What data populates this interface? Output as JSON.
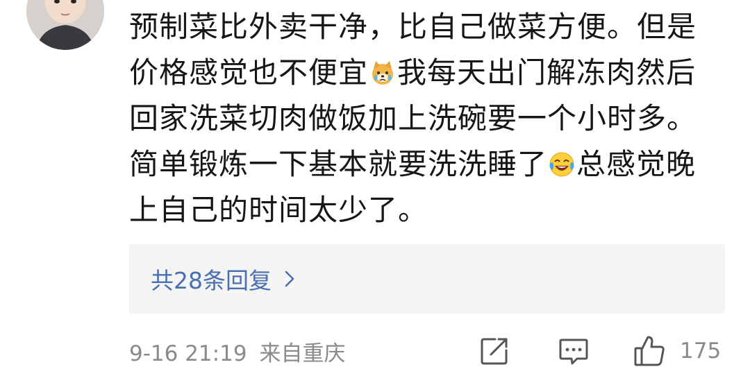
{
  "comment": {
    "lines": [
      [
        "预制菜比外卖干净，比自己做菜方便。但是"
      ],
      [
        "价格感觉也不便宜",
        "我每天出门解冻肉然后"
      ],
      [
        "回家洗菜切肉做饭加上洗碗要一个小时多。"
      ],
      [
        "简单锻炼一下基本就要洗洗睡了",
        "总感觉晚"
      ],
      [
        "上自己的时间太少了。"
      ]
    ],
    "emojis": [
      "crying-dog-emoji",
      "laughing-crying-emoji"
    ]
  },
  "replies": {
    "label": "共28条回复",
    "chevron_icon": "chevron-right-icon"
  },
  "footer": {
    "timestamp": "9-16 21:19",
    "location": "来自重庆",
    "icons": [
      "share-icon",
      "comment-icon",
      "thumbs-up-icon"
    ],
    "like_count": "175"
  },
  "colors": {
    "link": "#4a6fb0",
    "meta": "#8a8a8a",
    "reply_bg": "#f4f4f4",
    "text": "#161616"
  }
}
